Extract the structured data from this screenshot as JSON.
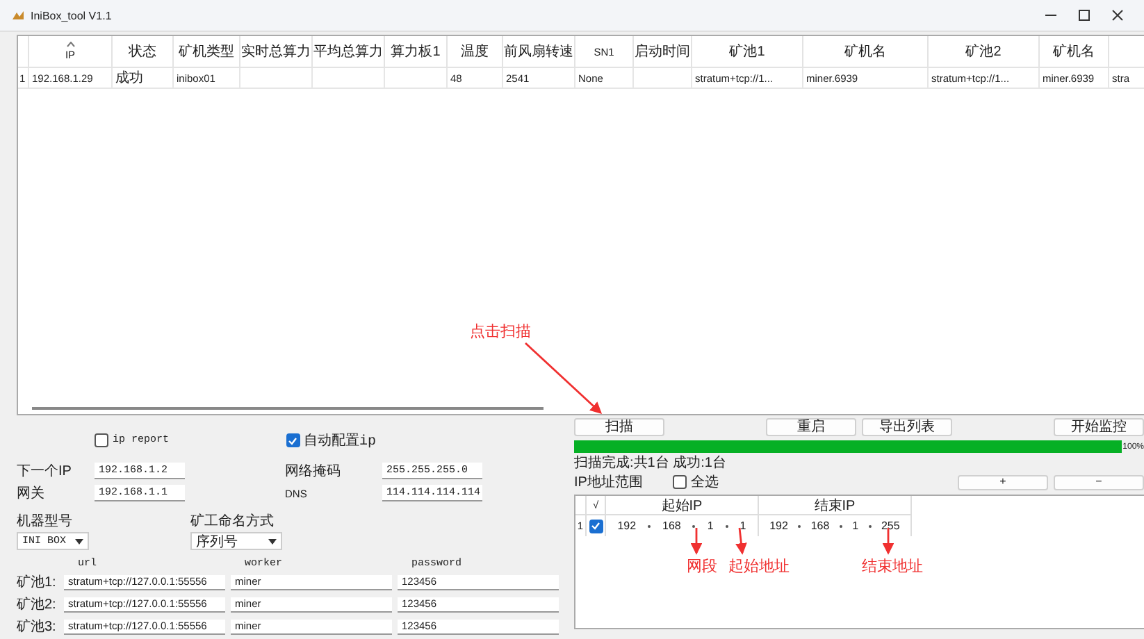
{
  "window": {
    "title": "IniBox_tool V1.1"
  },
  "devices_table": {
    "columns": [
      "IP",
      "状态",
      "矿机类型",
      "实时总算力",
      "平均总算力",
      "算力板1",
      "温度",
      "前风扇转速",
      "SN1",
      "启动时间",
      "矿池1",
      "矿机名",
      "矿池2",
      "矿机名"
    ],
    "rows": [
      {
        "index": "1",
        "cells": [
          "192.168.1.29",
          "成功",
          "inibox01",
          null,
          null,
          null,
          "48",
          "2541",
          "None",
          null,
          "stratum+tcp://1...",
          "miner.6939",
          "stratum+tcp://1...",
          "miner.6939",
          "stra"
        ]
      }
    ]
  },
  "options": [
    {
      "label": "ip report",
      "checked": false
    },
    {
      "label": "自动配置ip",
      "checked": true
    }
  ],
  "network_fields": [
    {
      "label": "下一个IP",
      "value": "192.168.1.2"
    },
    {
      "label": "网络掩码",
      "value": "255.255.255.0"
    },
    {
      "label": "网关",
      "value": "192.168.1.1"
    },
    {
      "label": "DNS",
      "value": "114.114.114.114"
    }
  ],
  "dropdowns": [
    {
      "label": "机器型号",
      "value": "INI BOX"
    },
    {
      "label": "矿工命名方式",
      "value": "序列号"
    }
  ],
  "pools": {
    "columns": [
      "url",
      "worker",
      "password"
    ],
    "rows": [
      {
        "label": "矿池1:",
        "url": "stratum+tcp://127.0.0.1:55556",
        "worker": "miner",
        "password": "123456"
      },
      {
        "label": "矿池2:",
        "url": "stratum+tcp://127.0.0.1:55556",
        "worker": "miner",
        "password": "123456"
      },
      {
        "label": "矿池3:",
        "url": "stratum+tcp://127.0.0.1:55556",
        "worker": "miner",
        "password": "123456"
      }
    ]
  },
  "buttons": [
    "扫描",
    "重启",
    "导出列表",
    "开始监控"
  ],
  "progress": {
    "level": 1,
    "reading": "100%"
  },
  "scan_status": "扫描完成:共1台 成功:1台",
  "ip_range": {
    "label": "IP地址范围",
    "select_all": {
      "label": "全选",
      "checked": false
    },
    "buttons": [
      "+",
      "−"
    ],
    "table": {
      "check_header": "√",
      "columns": [
        "起始IP",
        "结束IP"
      ],
      "rows": [
        {
          "index": "1",
          "checked": true,
          "start": [
            "192",
            "168",
            "1",
            "1"
          ],
          "end": [
            "192",
            "168",
            "1",
            "255"
          ]
        }
      ]
    }
  },
  "annotations": [
    "点击扫描",
    "网段",
    "起始地址",
    "结束地址"
  ]
}
